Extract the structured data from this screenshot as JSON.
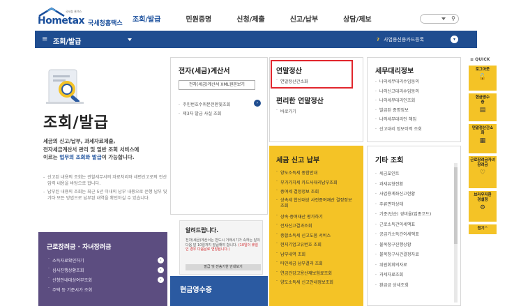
{
  "brand": {
    "logo_sub": "국세청 홈택스",
    "logo_main": "Hometax",
    "logo_kr": "국세청홈택스"
  },
  "nav": {
    "items": [
      "조회/발급",
      "민원증명",
      "신청/제출",
      "신고/납부",
      "상담/제보"
    ]
  },
  "bluebar": {
    "hamburger": "≡",
    "title": "조회/발급",
    "tip_mark": "?",
    "right_text": "사업용신용카드등록"
  },
  "hero": {
    "title": "조회/발급",
    "desc_1": "세금의 신고/납부, 과세자료제출,",
    "desc_2": "전자세금계산서 관리 및 일반 조회 서비스에",
    "desc_3_pre": "이르는 ",
    "desc_3_hl": "업무의 조회와 발급",
    "desc_3_post": "이 가능합니다.",
    "notes": [
      "신고된 내용의 조회는 관할세무서의 자료처리와 세변신고로의 전산 입력 내용을 바탕으로 합니다.",
      "납부된 내용의 조회는 최근 5년 이내의 납부 내용으로 은행 납부 및 기타 모든 방법으로 납부된 내역을 확인하실 수 있습니다."
    ]
  },
  "purple_box": {
    "title": "근로장려금 · 자녀장려금",
    "items": [
      "소득자료확인하기",
      "심사진행상황조회",
      "신청안내대상여부조회",
      "주택 등 기준시가 조회"
    ]
  },
  "panel_einvoice": {
    "title": "전자(세금)계산서",
    "button": "전자(세금)계산서 XML원본보기",
    "items": [
      "주민번호수취분전환및조회",
      "제3자 발급 사실 조회"
    ]
  },
  "panel_yearend": {
    "title": "연말정산",
    "items": [
      "연말정산간소화"
    ],
    "title2": "편리한 연말정산",
    "items2": [
      "바로가기"
    ]
  },
  "panel_agent": {
    "title": "세무대리정보",
    "items": [
      "나의세무대리수임동의",
      "나의신고대리수임동의",
      "나의세무대리인조회",
      "발급된 증명정보",
      "나의세무대리인 해임",
      "신고대리 정보이력 조회"
    ]
  },
  "notice": {
    "title": "알려드립니다.",
    "desc_1": "전자(세금)계산서는 반드시 거래시기가 속하는 달의 다음 달 10일까지 발급해야 합니다.",
    "desc_2": "(10일이 휴일인 경우 다음날로 연장됩니다.)",
    "button": "발급 및 전송기한 안내보기"
  },
  "receipt": {
    "title": "현금영수증"
  },
  "tax_box": {
    "title": "세금 신고 납부",
    "items": [
      "양도소득세 종합안내",
      "부가가치세 카드사대리납부조회",
      "증여세 결정정보 조회",
      "상속세 합산대상 사전증여재산 결정정보 조회",
      "상속·증여재산 평가하기",
      "전자신고결과조회",
      "종합소득세 신고도움 서비스",
      "현지기업고유번호 조회",
      "납부내역 조회",
      "타인세금 납부결과 조회",
      "연금건강고용산재보험료조회",
      "양도소득세 신고안내정보조회"
    ]
  },
  "other_box": {
    "title": "기타 조회",
    "items": [
      "세금포인트",
      "과세유형전환",
      "사업용계좌신고현황",
      "주류면허상태",
      "기준(단순) 경비율(업종코드)",
      "근로소득간이세액표",
      "공급가소득간이세액표",
      "불복청구진행상황",
      "불복청구사건결정자료",
      "위원회회의자료",
      "과세자료조회",
      "환급금 상세조회"
    ]
  },
  "quick": {
    "header": "≡ QUICK",
    "items": [
      {
        "label": "로그아웃",
        "icon": "lock-icon"
      },
      {
        "label": "현금영수증",
        "icon": "receipt-icon"
      },
      {
        "label": "연말정산간소화",
        "icon": "doc-icon"
      },
      {
        "label": "근로장려금자녀장려금",
        "icon": "heart-icon"
      },
      {
        "label": "브라우저환경설정",
        "icon": "gear-icon"
      },
      {
        "label": "접기^",
        "icon": ""
      }
    ]
  },
  "colors": {
    "brand_blue": "#1f4d90",
    "yellow": "#f4c326",
    "purple": "#5c4d80",
    "highlight_red": "#e1262d"
  }
}
